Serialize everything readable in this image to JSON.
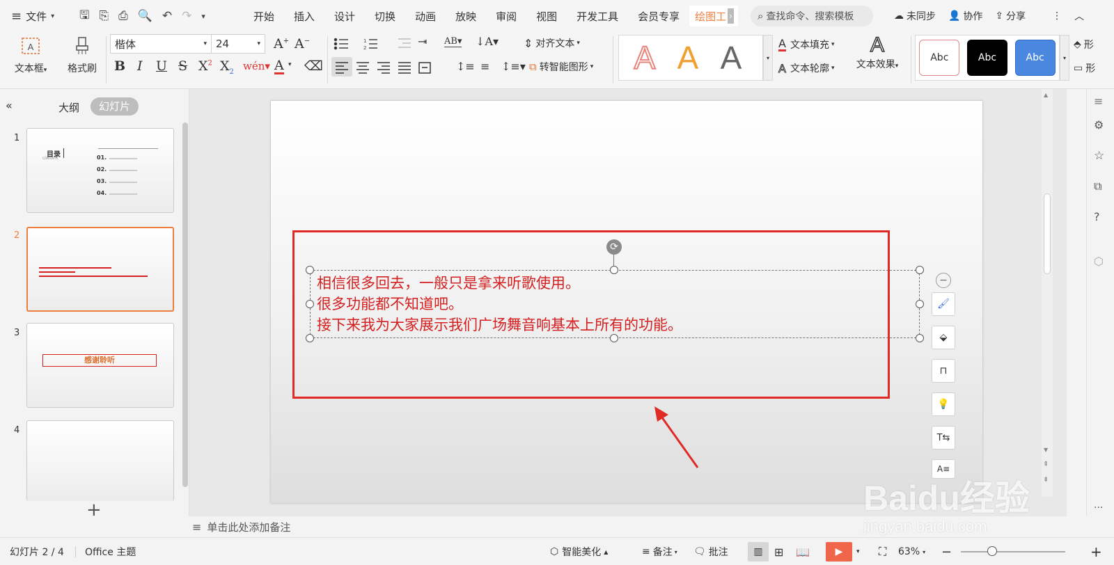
{
  "menu": {
    "file": "文件",
    "tabs": [
      "开始",
      "插入",
      "设计",
      "切换",
      "动画",
      "放映",
      "审阅",
      "视图",
      "开发工具",
      "会员专享"
    ],
    "active_tab": "绘图工",
    "search_placeholder": "查找命令、搜索模板",
    "sync": "未同步",
    "collab": "协作",
    "share": "分享"
  },
  "ribbon": {
    "textbox": "文本框",
    "format_painter": "格式刷",
    "font_name": "楷体",
    "font_size": "24",
    "align_text": "对齐文本",
    "smart_shape": "转智能图形",
    "text_fill": "文本填充",
    "text_outline": "文本轮廓",
    "text_effect": "文本效果",
    "wordart_sample": "A",
    "style_sample": "Abc",
    "shape_fill_cut": "形",
    "shape_outline_cut": "形"
  },
  "left_panel": {
    "tab_outline": "大纲",
    "tab_slides": "幻灯片",
    "slides": [
      {
        "num": "1",
        "title": "目录",
        "subtitle": "CONTENTS",
        "items": [
          "01.",
          "02.",
          "03.",
          "04."
        ]
      },
      {
        "num": "2"
      },
      {
        "num": "3",
        "title": "感谢聆听"
      },
      {
        "num": "4"
      }
    ]
  },
  "slide": {
    "lines": [
      "相信很多回去，一般只是拿来听歌使用。",
      "很多功能都不知道吧。",
      "接下来我为大家展示我们广场舞音响基本上所有的功能。"
    ]
  },
  "notes_placeholder": "单击此处添加备注",
  "status": {
    "slide_counter": "幻灯片 2 / 4",
    "theme": "Office 主题",
    "beautify": "智能美化",
    "notes": "备注",
    "comments": "批注",
    "zoom": "63%"
  },
  "watermark": {
    "text": "Baidu经验",
    "sub": "jingyan.baidu.com"
  },
  "colors": {
    "accent": "#d42020",
    "highlight_box": "#e02a25",
    "active_thumb": "#ef7e3c",
    "play": "#f0664a",
    "wordart_orange": "#f0a030"
  }
}
